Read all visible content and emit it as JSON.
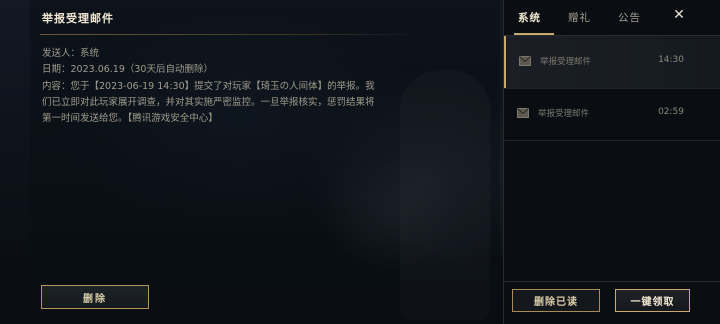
{
  "mail": {
    "title": "举报受理邮件",
    "sender": "发送人：系统",
    "date": "日期：2023.06.19（30天后自动删除）",
    "body": "内容：您于【2023-06-19 14:30】提交了对玩家【琦玉の人间体】的举报。我们已立即对此玩家展开调查，并对其实施严密监控。一旦举报核实，惩罚结果将第一时间发送给您。【腾讯游戏安全中心】",
    "delete_label": "删除"
  },
  "tabs": [
    {
      "label": "系统",
      "active": true
    },
    {
      "label": "赠礼",
      "active": false
    },
    {
      "label": "公告",
      "active": false
    }
  ],
  "close_label": "✕",
  "mail_list": [
    {
      "label": "举报受理邮件",
      "time": "14:30",
      "selected": true,
      "icon": "envelope-icon"
    },
    {
      "label": "举报受理邮件",
      "time": "02:59",
      "selected": false,
      "icon": "envelope-icon"
    }
  ],
  "actions": {
    "delete_read_label": "删除已读",
    "claim_all_label": "一键领取"
  },
  "colors": {
    "accent_gold": "#c8aa6e",
    "text_gold": "#f0e6d2",
    "text_muted": "#a09b8c"
  }
}
